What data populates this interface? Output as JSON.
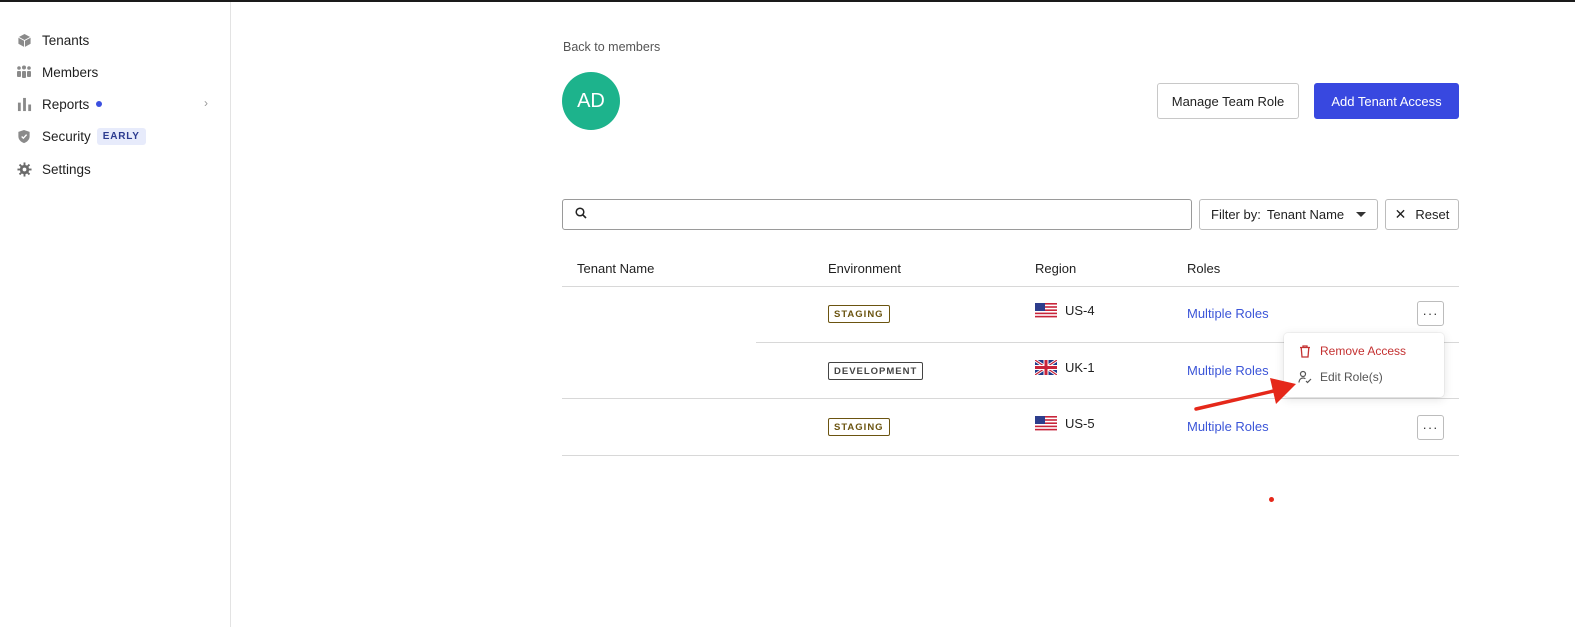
{
  "sidebar": {
    "items": [
      {
        "label": "Tenants",
        "icon": "cube-icon"
      },
      {
        "label": "Members",
        "icon": "members-icon"
      },
      {
        "label": "Reports",
        "icon": "bar-chart-icon",
        "has_dot": true,
        "has_chevron": true
      },
      {
        "label": "Security",
        "icon": "shield-icon",
        "badge": "EARLY"
      },
      {
        "label": "Settings",
        "icon": "gear-icon"
      }
    ]
  },
  "header": {
    "back_label": "Back to members",
    "avatar_initials": "AD",
    "avatar_color": "#1db38c",
    "manage_role_label": "Manage Team Role",
    "add_access_label": "Add Tenant Access",
    "accent_color": "#3848e0"
  },
  "toolbar": {
    "search_value": "",
    "search_placeholder": "",
    "filter_prefix": "Filter by:",
    "filter_value": "Tenant Name",
    "reset_label": "Reset"
  },
  "table": {
    "columns": [
      "Tenant Name",
      "Environment",
      "Region",
      "Roles"
    ],
    "rows": [
      {
        "tenant": "",
        "environment": "STAGING",
        "region": "US-4",
        "flag": "us-flag-icon",
        "roles": "Multiple Roles"
      },
      {
        "tenant": "",
        "environment": "DEVELOPMENT",
        "region": "UK-1",
        "flag": "uk-flag-icon",
        "roles": "Multiple Roles"
      },
      {
        "tenant": "",
        "environment": "STAGING",
        "region": "US-5",
        "flag": "us-flag-icon",
        "roles": "Multiple Roles"
      }
    ],
    "more_label": "···"
  },
  "row_menu": {
    "remove_label": "Remove Access",
    "edit_label": "Edit Role(s)",
    "danger_color": "#c43131"
  }
}
